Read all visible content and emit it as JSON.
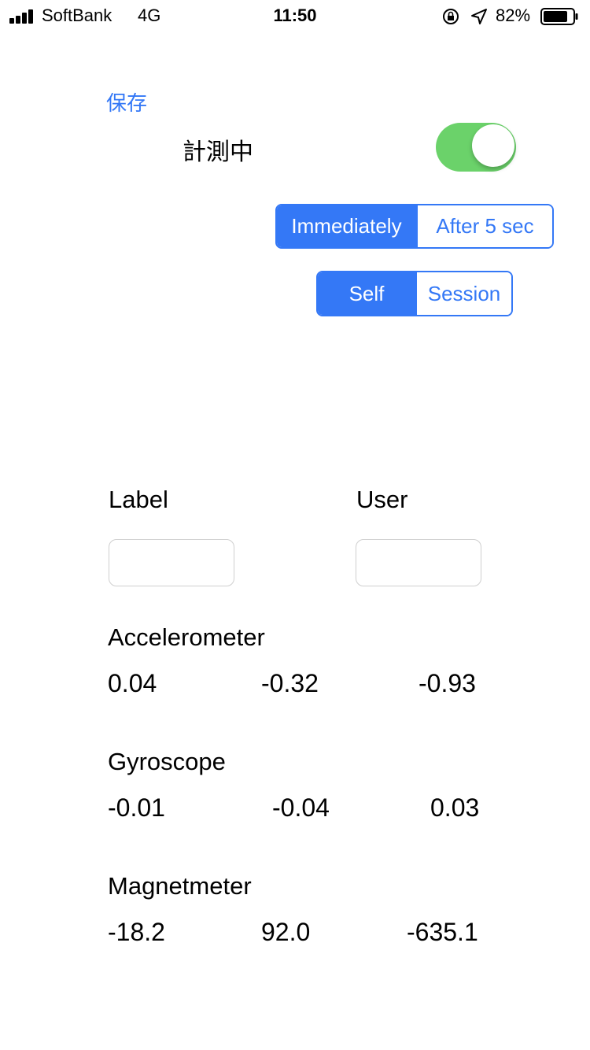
{
  "status_bar": {
    "carrier": "SoftBank",
    "network": "4G",
    "time": "11:50",
    "battery_percent": "82%",
    "battery_level": 0.82,
    "icons": [
      "signal-icon",
      "orientation-lock-icon",
      "location-arrow-icon",
      "battery-icon"
    ]
  },
  "toolbar": {
    "save_label": "保存"
  },
  "measurement": {
    "label": "計測中",
    "toggle_on": true,
    "toggle_color": "#6bd26a"
  },
  "timing_segment": {
    "options": [
      "Immediately",
      "After 5 sec"
    ],
    "selected": "Immediately"
  },
  "mode_segment": {
    "options": [
      "Self",
      "Session"
    ],
    "selected": "Self"
  },
  "fields": {
    "label_title": "Label",
    "label_value": "",
    "user_title": "User",
    "user_value": ""
  },
  "sensors": {
    "accelerometer": {
      "title": "Accelerometer",
      "values": [
        "0.04",
        "-0.32",
        "-0.93"
      ]
    },
    "gyroscope": {
      "title": "Gyroscope",
      "values": [
        "-0.01",
        "-0.04",
        "0.03"
      ]
    },
    "magnetometer": {
      "title": "Magnetmeter",
      "values": [
        "-18.2",
        "92.0",
        "-635.1"
      ]
    }
  },
  "colors": {
    "accent": "#3478f6",
    "toggle_on": "#6bd26a"
  }
}
